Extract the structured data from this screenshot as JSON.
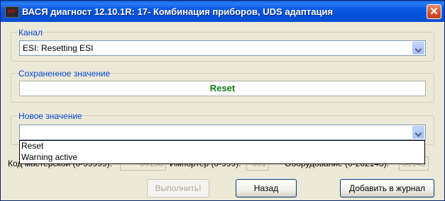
{
  "window": {
    "title": "ВАСЯ диагност 12.10.1R: 17- Комбинация приборов,  UDS адаптация",
    "close_glyph": "✕"
  },
  "channel": {
    "label": "Канал",
    "value": "ESI: Resetting ESI"
  },
  "saved": {
    "label": "Сохраненное значение",
    "value": "Reset",
    "value_color": "#137a13"
  },
  "new_value": {
    "label": "Новое значение",
    "value": "",
    "options": [
      "Reset",
      "Warning active"
    ]
  },
  "coding": {
    "workshop_label": "Код мастерской (0-99999):",
    "workshop_value": "00158",
    "importer_label": "Импортер (0-999):",
    "importer_value": "001",
    "equipment_label": "Оборудование (0-262143):",
    "equipment_value": "00145"
  },
  "buttons": {
    "execute": "Выполнить!",
    "back": "Назад",
    "add_log": "Добавить в журнал"
  },
  "colors": {
    "titlebar": "#0858e0",
    "group_label": "#0046d5",
    "background": "#ece9d8"
  }
}
